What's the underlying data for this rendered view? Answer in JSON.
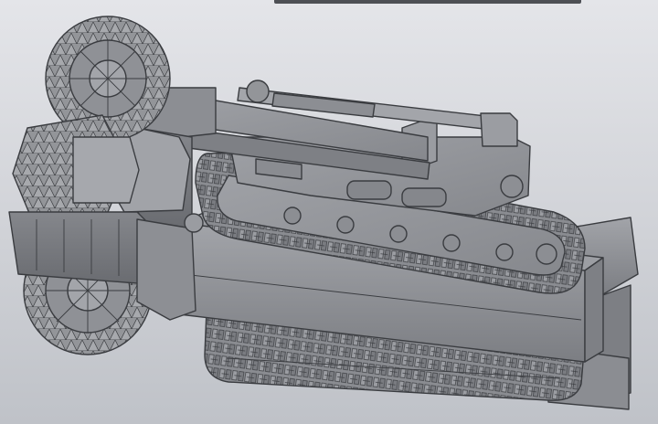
{
  "viewport": {
    "kind": "3D CAD model view",
    "background_top": "#e4e5e9",
    "background_bottom": "#bfc2c8",
    "model_color": "#8f9196",
    "edge_color": "#3a3c40"
  },
  "model": {
    "icon": "tracked-mining-machine-icon",
    "parts": [
      "cutter-drums",
      "boom-arm",
      "hydraulic-cylinder",
      "upper-track",
      "lower-track",
      "main-chassis",
      "rear-deck"
    ]
  }
}
